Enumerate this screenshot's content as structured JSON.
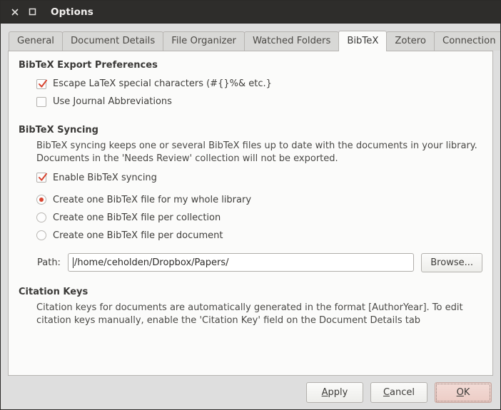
{
  "window": {
    "title": "Options",
    "close_icon": "close-icon",
    "maximize_icon": "maximize-icon"
  },
  "tabs": [
    {
      "label": "General",
      "active": false
    },
    {
      "label": "Document Details",
      "active": false
    },
    {
      "label": "File Organizer",
      "active": false
    },
    {
      "label": "Watched Folders",
      "active": false
    },
    {
      "label": "BibTeX",
      "active": true
    },
    {
      "label": "Zotero",
      "active": false
    },
    {
      "label": "Connection",
      "active": false
    }
  ],
  "export_preferences": {
    "title": "BibTeX Export Preferences",
    "options": [
      {
        "label": "Escape LaTeX special characters (#{}%& etc.}",
        "checked": true
      },
      {
        "label": "Use Journal Abbreviations",
        "checked": false
      }
    ]
  },
  "syncing": {
    "title": "BibTeX Syncing",
    "description_line1": "BibTeX syncing keeps one or several BibTeX files up to date with the documents in your library.",
    "description_line2": "Documents in the 'Needs Review' collection will not be exported.",
    "enable_label": "Enable BibTeX syncing",
    "enable_checked": true,
    "radio_options": [
      {
        "label": "Create one BibTeX file for my whole library",
        "selected": true
      },
      {
        "label": "Create one BibTeX file per collection",
        "selected": false
      },
      {
        "label": "Create one BibTeX file per document",
        "selected": false
      }
    ],
    "path_label": "Path:",
    "path_value": "/home/ceholden/Dropbox/Papers/",
    "browse_label": "Browse..."
  },
  "citation_keys": {
    "title": "Citation Keys",
    "description_line1": "Citation keys for documents are automatically generated in the format [AuthorYear]. To edit",
    "description_line2": "citation keys manually, enable the 'Citation Key' field on the Document Details tab"
  },
  "footer": {
    "apply": {
      "pre": "",
      "mnemonic": "A",
      "post": "pply"
    },
    "cancel": {
      "pre": "",
      "mnemonic": "C",
      "post": "ancel"
    },
    "ok": {
      "pre": "",
      "mnemonic": "O",
      "post": "K"
    }
  },
  "colors": {
    "accent_red": "#d8442f",
    "titlebar_bg": "#2e2d2b",
    "dialog_bg": "#dedede",
    "panel_bg": "#fbfbfa",
    "default_button_bg": "#ecccc5"
  }
}
